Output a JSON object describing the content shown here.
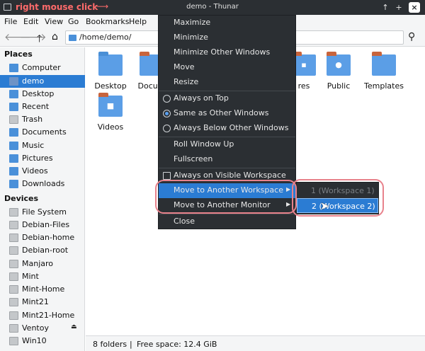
{
  "annotation": "right mouse click",
  "window": {
    "title": "demo - Thunar"
  },
  "menubar": [
    "File",
    "Edit",
    "View",
    "Go",
    "Bookmarks",
    "Help"
  ],
  "path": "/home/demo/",
  "sidebar": {
    "places_header": "Places",
    "places": [
      {
        "label": "Computer",
        "icon": "computer-icon"
      },
      {
        "label": "demo",
        "icon": "home-folder-icon",
        "selected": true
      },
      {
        "label": "Desktop",
        "icon": "desktop-folder-icon"
      },
      {
        "label": "Recent",
        "icon": "recent-folder-icon"
      },
      {
        "label": "Trash",
        "icon": "trash-icon"
      },
      {
        "label": "Documents",
        "icon": "documents-folder-icon"
      },
      {
        "label": "Music",
        "icon": "music-folder-icon"
      },
      {
        "label": "Pictures",
        "icon": "pictures-folder-icon"
      },
      {
        "label": "Videos",
        "icon": "videos-folder-icon"
      },
      {
        "label": "Downloads",
        "icon": "downloads-folder-icon"
      }
    ],
    "devices_header": "Devices",
    "devices": [
      {
        "label": "File System",
        "icon": "drive-icon"
      },
      {
        "label": "Debian-Files",
        "icon": "drive-icon"
      },
      {
        "label": "Debian-home",
        "icon": "drive-icon"
      },
      {
        "label": "Debian-root",
        "icon": "drive-icon"
      },
      {
        "label": "Manjaro",
        "icon": "drive-icon"
      },
      {
        "label": "Mint",
        "icon": "drive-icon"
      },
      {
        "label": "Mint-Home",
        "icon": "drive-icon"
      },
      {
        "label": "Mint21",
        "icon": "drive-icon"
      },
      {
        "label": "Mint21-Home",
        "icon": "drive-icon"
      },
      {
        "label": "Ventoy",
        "icon": "drive-icon",
        "eject": true
      },
      {
        "label": "Win10",
        "icon": "drive-icon"
      }
    ]
  },
  "files": [
    {
      "label": "Desktop",
      "icon": "desktop-folder-icon"
    },
    {
      "label": "Docum",
      "icon": "documents-folder-icon"
    },
    {
      "label": "res",
      "icon": "pictures-folder-icon"
    },
    {
      "label": "Public",
      "icon": "public-folder-icon"
    },
    {
      "label": "Templates",
      "icon": "templates-folder-icon"
    },
    {
      "label": "Videos",
      "icon": "videos-folder-icon"
    }
  ],
  "status": {
    "folders": "8 folders",
    "sep": "|",
    "free": "Free space: 12.4 GiB"
  },
  "context_menu": {
    "maximize": "Maximize",
    "minimize": "Minimize",
    "minimize_other": "Minimize Other Windows",
    "move": "Move",
    "resize": "Resize",
    "always_on_top": "Always on Top",
    "same_as_other": "Same as Other Windows",
    "always_below": "Always Below Other Windows",
    "roll_up": "Roll Window Up",
    "fullscreen": "Fullscreen",
    "always_visible": "Always on Visible Workspace",
    "move_workspace": "Move to Another Workspace",
    "move_monitor": "Move to Another Monitor",
    "close": "Close"
  },
  "submenu": {
    "ws1": "1 (Workspace 1)",
    "ws2": "2 (Workspace 2)"
  },
  "colors": {
    "accent": "#2b7cd3",
    "menu_bg": "#2b2f33",
    "annotation": "#ff6b6b",
    "highlight_ring": "#e8828c"
  }
}
